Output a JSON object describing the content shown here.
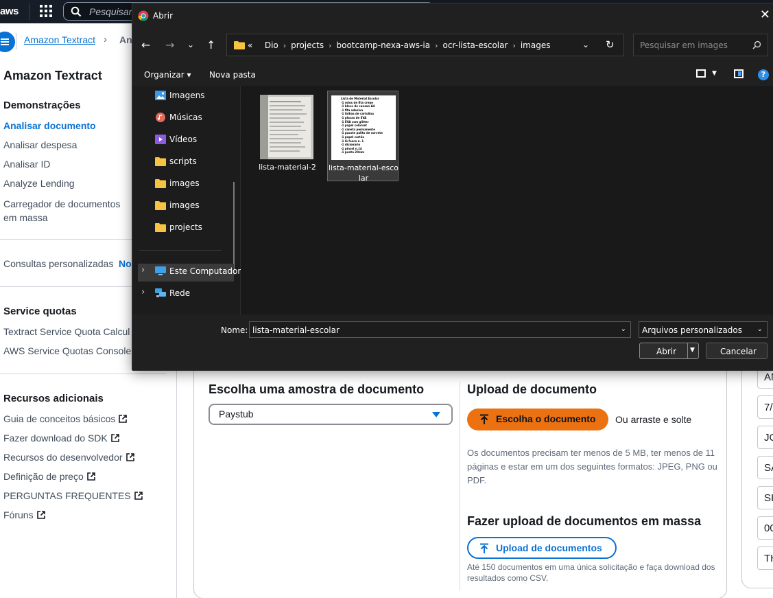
{
  "topbar": {
    "logo": "aws",
    "search_placeholder": "Pesquisar"
  },
  "breadcrumb": {
    "service": "Amazon Textract",
    "current": "An"
  },
  "sidebar": {
    "title": "Amazon Textract",
    "demos_heading": "Demonstrações",
    "demos": [
      {
        "label": "Analisar documento",
        "active": true
      },
      {
        "label": "Analisar despesa"
      },
      {
        "label": "Analisar ID"
      },
      {
        "label": "Analyze Lending"
      },
      {
        "label": "Carregador de documentos em massa"
      }
    ],
    "custom_queries": "Consultas personalizadas",
    "custom_queries_badge": "No",
    "quotas_heading": "Service quotas",
    "quotas": [
      {
        "label": "Textract Service Quota Calcul"
      },
      {
        "label": "AWS Service Quotas Console"
      }
    ],
    "resources_heading": "Recursos adicionais",
    "resources": [
      {
        "label": "Guia de conceitos básicos"
      },
      {
        "label": "Fazer download do SDK"
      },
      {
        "label": "Recursos do desenvolvedor"
      },
      {
        "label": "Definição de preço"
      },
      {
        "label": "PERGUNTAS FREQUENTES"
      },
      {
        "label": "Fóruns"
      }
    ]
  },
  "main": {
    "sample_title": "Escolha uma amostra de documento",
    "sample_select_value": "Paystub",
    "upload_title": "Upload de documento",
    "choose_button": "Escolha o documento",
    "drag_text": "Ou arraste e solte",
    "upload_note": "Os documentos precisam ter menos de 5 MB, ter menos de 11 páginas e estar em um dos seguintes formatos: JPEG, PNG ou PDF.",
    "bulk_title": "Fazer upload de documentos em massa",
    "bulk_button": "Upload de documentos",
    "bulk_note": "Até 150 documentos em uma única solicitação e faça download dos resultados como CSV.",
    "right_cells": [
      "AN",
      "7/",
      "JO",
      "SA",
      "SI",
      "00",
      "TH"
    ]
  },
  "dialog": {
    "title": "Abrir",
    "address_prefix": "«",
    "address_path": [
      "Dio",
      "projects",
      "bootcamp-nexa-aws-ia",
      "ocr-lista-escolar",
      "images"
    ],
    "search_placeholder": "Pesquisar em images",
    "organize": "Organizar ▾",
    "new_folder": "Nova pasta",
    "help": "?",
    "nav_items": [
      {
        "label": "Imagens",
        "icon": "pictures-icon",
        "pinned": true
      },
      {
        "label": "Músicas",
        "icon": "music-icon",
        "pinned": true
      },
      {
        "label": "Vídeos",
        "icon": "videos-icon",
        "pinned": true
      },
      {
        "label": "scripts",
        "icon": "folder-icon"
      },
      {
        "label": "images",
        "icon": "folder-icon"
      },
      {
        "label": "images",
        "icon": "folder-icon"
      },
      {
        "label": "projects",
        "icon": "folder-icon"
      },
      {
        "label": "Este Computador",
        "icon": "computer-icon"
      },
      {
        "label": "Rede",
        "icon": "network-icon"
      }
    ],
    "files": [
      {
        "name": "lista-material-2",
        "selected": false
      },
      {
        "name": "lista-material-escolar",
        "selected": true
      }
    ],
    "thumb_doc_lines": [
      "Lista de Material Escolar",
      "-1 rolos de fita crepe",
      "-1 bloco de canson A4",
      "-1 fita adesiva",
      "-1 folhas de cartolina",
      "-1 placas de EVA",
      "-1 EVA com glitter",
      "-1 papel colorset",
      "-1 caneta permanente",
      "-1 pacote palito de sorvete",
      "-1 papel cartão",
      "-1 lã fosca n. 1",
      "-1 dicionário",
      "-1 pincel n.14",
      "-1 ponta 20mm"
    ],
    "name_label": "Nome:",
    "name_value": "lista-material-escolar",
    "filter_value": "Arquivos personalizados",
    "open_button": "Abrir",
    "cancel_button": "Cancelar"
  }
}
